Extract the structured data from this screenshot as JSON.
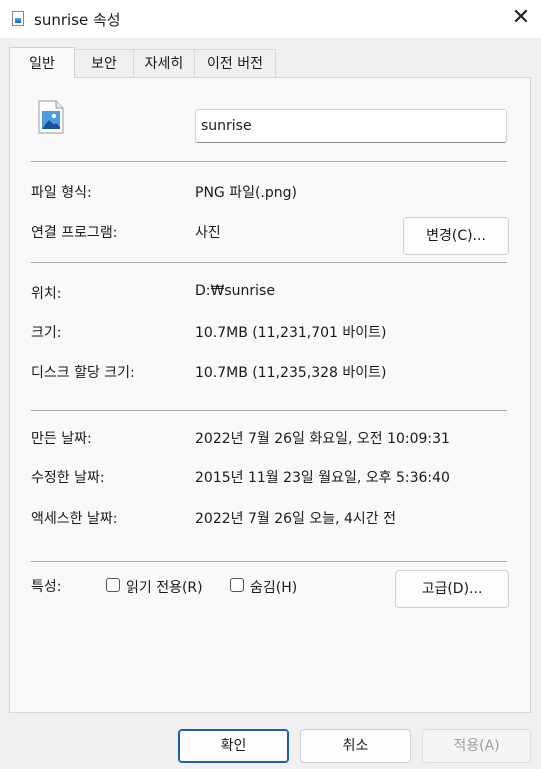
{
  "window": {
    "title": "sunrise 속성"
  },
  "tabs": [
    {
      "label": "일반"
    },
    {
      "label": "보안"
    },
    {
      "label": "자세히"
    },
    {
      "label": "이전 버전"
    }
  ],
  "general": {
    "file_name": "sunrise",
    "file_type_label": "파일 형식:",
    "file_type_value": "PNG 파일(.png)",
    "opens_with_label": "연결 프로그램:",
    "opens_with_value": "사진",
    "change_button": "변경(C)...",
    "location_label": "위치:",
    "location_value": "D:₩sunrise",
    "size_label": "크기:",
    "size_value": "10.7MB (11,231,701 바이트)",
    "size_on_disk_label": "디스크 할당 크기:",
    "size_on_disk_value": "10.7MB (11,235,328 바이트)",
    "created_label": "만든 날짜:",
    "created_value": "2022년 7월 26일 화요일, 오전 10:09:31",
    "modified_label": "수정한 날짜:",
    "modified_value": "2015년 11월 23일 월요일, 오후 5:36:40",
    "accessed_label": "액세스한 날짜:",
    "accessed_value": "2022년 7월 26일 오늘, 4시간 전",
    "attributes_label": "특성:",
    "readonly_label": "읽기 전용(R)",
    "hidden_label": "숨김(H)",
    "advanced_button": "고급(D)..."
  },
  "footer": {
    "ok": "확인",
    "cancel": "취소",
    "apply": "적용(A)"
  },
  "icons": {
    "app": "image-file-icon",
    "close": "close-icon",
    "file": "image-file-icon"
  },
  "colors": {
    "accent": "#1a5fb4",
    "disabled_text": "#9e9e9e"
  }
}
